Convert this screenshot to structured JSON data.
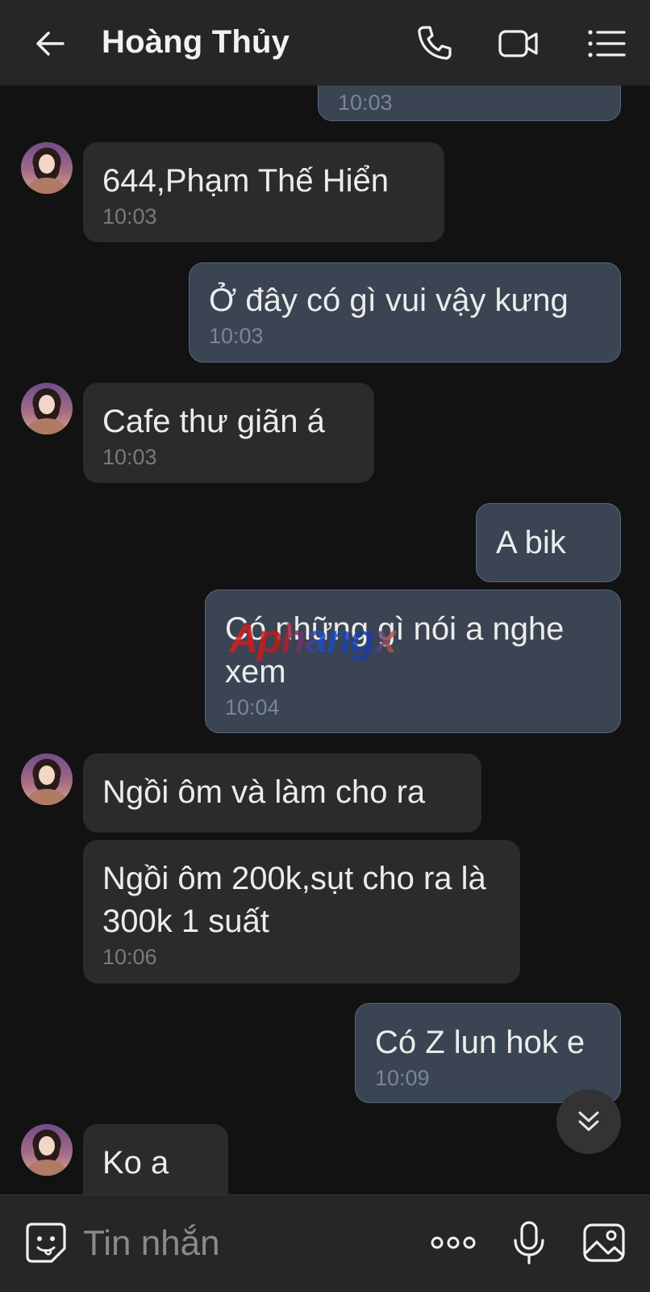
{
  "header": {
    "title": "Hoàng Thủy",
    "back_icon": "arrow-left-icon",
    "call_icon": "phone-icon",
    "video_icon": "video-camera-icon",
    "menu_icon": "list-menu-icon"
  },
  "messages": [
    {
      "dir": "out",
      "text": "",
      "time": "10:03"
    },
    {
      "dir": "in",
      "text": "644,Phạm Thế Hiển",
      "time": "10:03"
    },
    {
      "dir": "out",
      "text": "Ở đây có gì vui vậy kưng",
      "time": "10:03"
    },
    {
      "dir": "in",
      "text": "Cafe thư giãn á",
      "time": "10:03"
    },
    {
      "dir": "out",
      "text": "A bik",
      "time": ""
    },
    {
      "dir": "out",
      "text": "Có những gì nói a nghe xem",
      "time": "10:04"
    },
    {
      "dir": "in",
      "text": "Ngồi ôm và làm cho ra",
      "time": ""
    },
    {
      "dir": "in",
      "text": "Ngồi ôm 200k,sụt cho ra là 300k 1 suất",
      "time": "10:06"
    },
    {
      "dir": "out",
      "text": "Có Z lun hok e",
      "time": "10:09"
    },
    {
      "dir": "in",
      "text": "Ko a",
      "time": ""
    }
  ],
  "watermark": "Aphangx",
  "composer": {
    "placeholder": "Tin nhắn",
    "emoji_icon": "emoji-sticker-icon",
    "more_icon": "more-dots-icon",
    "mic_icon": "microphone-icon",
    "image_icon": "image-gallery-icon"
  },
  "scroll_button_icon": "double-chevron-down-icon",
  "colors": {
    "background": "#121212",
    "header": "#262626",
    "incoming_bubble": "#2b2b2b",
    "outgoing_bubble": "#3a4452",
    "outgoing_border": "#56677c"
  }
}
